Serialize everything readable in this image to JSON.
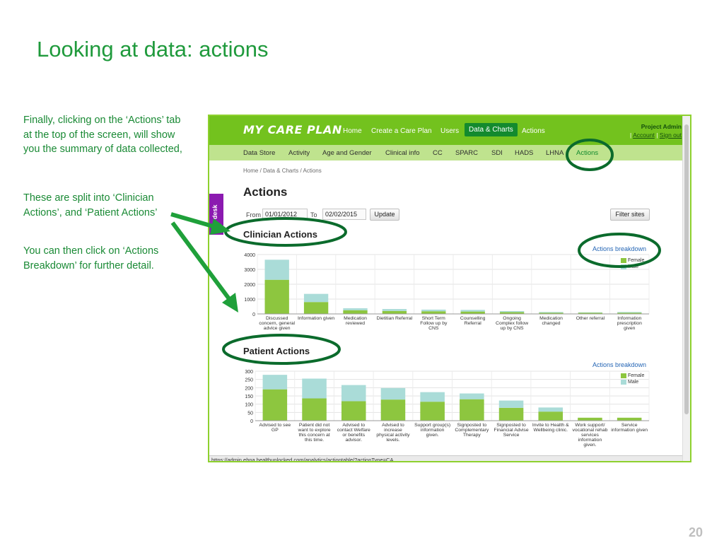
{
  "slide": {
    "title": "Looking at data: actions",
    "paragraphs": [
      "Finally, clicking on the ‘Actions’ tab at the top of the screen, will show you the summary of data collected,",
      "These are split into ‘Clinician Actions’, and ‘Patient Actions’",
      "You can then click on ‘Actions Breakdown’ for further detail."
    ],
    "page_number": "20"
  },
  "app": {
    "logo": "MY CARE PLAN",
    "nav": [
      "Home",
      "Create a Care Plan",
      "Users",
      "Data & Charts",
      "Actions"
    ],
    "active_nav": "Data & Charts",
    "admin_name": "Project Admin",
    "account_link": "Account",
    "separator": "|",
    "signout_link": "Sign out",
    "subnav": [
      "Data Store",
      "Activity",
      "Age and Gender",
      "Clinical info",
      "CC",
      "SPARC",
      "SDI",
      "HADS",
      "LHNA",
      "Actions"
    ],
    "active_subnav": "Actions",
    "breadcrumb": "Home / Data & Charts / Actions",
    "page_title": "Actions",
    "from_label": "From",
    "from_value": "01/01/2012",
    "to_label": "To",
    "to_value": "02/02/2015",
    "update_button": "Update",
    "filter_button": "Filter sites",
    "sidebar_tab": "desk",
    "status_url": "https://admin.ehna.healthunlocked.com/analytics/actiontable/?actionType=CA"
  },
  "colors": {
    "female": "#8dc63f",
    "male": "#aadcd8",
    "green_nav": "#73c21e",
    "annotation": "#0b6b2c"
  },
  "chart_data": [
    {
      "type": "bar",
      "stacked": true,
      "title": "Clinician Actions",
      "link": "Actions breakdown",
      "categories": [
        "Discussed concern, general advice given",
        "Information given",
        "Medication reviewed",
        "Dietitian Referral",
        "Short Term Follow up by CNS",
        "Counselling Referral",
        "Ongoing Complex follow up by CNS",
        "Medication changed",
        "Other referral",
        "Information prescription given"
      ],
      "category_lines": [
        [
          "Discussed",
          "concern, general",
          "advice given"
        ],
        [
          "Information given"
        ],
        [
          "Medication",
          "reviewed"
        ],
        [
          "Dietitian Referral"
        ],
        [
          "Short Term",
          "Follow up by",
          "CNS"
        ],
        [
          "Counselling",
          "Referral"
        ],
        [
          "Ongoing",
          "Complex follow",
          "up by CNS"
        ],
        [
          "Medication",
          "changed"
        ],
        [
          "Other referral"
        ],
        [
          "Information",
          "prescription",
          "given"
        ]
      ],
      "series": [
        {
          "name": "Female",
          "values": [
            2300,
            800,
            250,
            200,
            180,
            160,
            120,
            80,
            80,
            80
          ]
        },
        {
          "name": "Male",
          "values": [
            1350,
            550,
            130,
            130,
            110,
            110,
            70,
            50,
            30,
            50
          ]
        }
      ],
      "yticks": [
        0,
        1000,
        2000,
        3000,
        4000
      ],
      "ylim": [
        0,
        4000
      ],
      "legend_position": "top-right"
    },
    {
      "type": "bar",
      "stacked": true,
      "title": "Patient Actions",
      "link": "Actions breakdown",
      "categories": [
        "Advised to see GP",
        "Patient did not want to explore this concern at this time.",
        "Advised to contact Welfare or benefits advisor.",
        "Advised to increase physical activity levels.",
        "Support group(s) information given.",
        "Signposted to Complementary Therapy",
        "Signposted to Financial Advise Service",
        "Invite to Health & Wellbeing clinic.",
        "Work support/ vocational rehab services information given.",
        "Service information given"
      ],
      "category_lines": [
        [
          "Advised to see",
          "GP"
        ],
        [
          "Patient did not",
          "want to explore",
          "this concern at",
          "this time."
        ],
        [
          "Advised to",
          "contact Welfare",
          "or benefits",
          "advisor."
        ],
        [
          "Advised to",
          "increase",
          "physical activity",
          "levels."
        ],
        [
          "Support group(s)",
          "information",
          "given."
        ],
        [
          "Signposted to",
          "Complementary",
          "Therapy"
        ],
        [
          "Signposted to",
          "Financial Advise",
          "Service"
        ],
        [
          "Invite to Health &",
          "Wellbeing clinic."
        ],
        [
          "Work support/",
          "vocational rehab",
          "services",
          "information",
          "given."
        ],
        [
          "Service",
          "information given"
        ]
      ],
      "series": [
        {
          "name": "Female",
          "values": [
            190,
            135,
            118,
            128,
            115,
            130,
            78,
            55,
            18,
            18
          ]
        },
        {
          "name": "Male",
          "values": [
            88,
            120,
            98,
            70,
            58,
            35,
            44,
            25,
            0,
            0
          ]
        }
      ],
      "yticks": [
        0,
        50,
        100,
        150,
        200,
        250,
        300
      ],
      "ylim": [
        0,
        300
      ],
      "legend_position": "top-right"
    }
  ]
}
